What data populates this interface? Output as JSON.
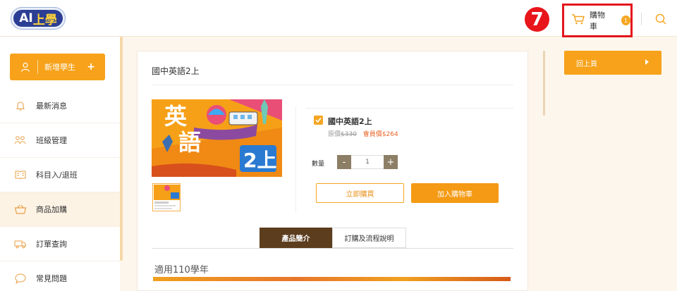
{
  "header": {
    "logo_left": "AI",
    "logo_right": "上學",
    "annotation_number": "7",
    "cart_label": "購物車",
    "cart_count": "1"
  },
  "sidebar": {
    "add_student_label": "新增學生",
    "add_student_plus": "+",
    "items": [
      {
        "label": "最新消息",
        "icon": "bell-icon"
      },
      {
        "label": "班級管理",
        "icon": "people-icon"
      },
      {
        "label": "科目入/退班",
        "icon": "book-icon"
      },
      {
        "label": "商品加購",
        "icon": "basket-icon",
        "active": true
      },
      {
        "label": "訂單查詢",
        "icon": "truck-icon"
      },
      {
        "label": "常見問題",
        "icon": "chat-icon"
      }
    ]
  },
  "product": {
    "title": "國中英語2上",
    "image_text_main": "英語",
    "image_badge": "2上",
    "option_name": "國中英語2上",
    "original_label": "原價",
    "original_price": "$330",
    "member_label": "會員價",
    "member_price": "$264",
    "qty_label": "數量",
    "qty_minus": "-",
    "qty_value": "1",
    "qty_plus": "+",
    "buy_now": "立即購買",
    "add_to_cart": "加入購物車"
  },
  "tabs": {
    "intro": "產品簡介",
    "flow": "訂購及流程說明"
  },
  "content": {
    "applicable": "適用110學年"
  },
  "right_panel": {
    "back_label": "回上頁"
  },
  "colors": {
    "accent": "#f7a21a",
    "highlight_red": "#e3151b",
    "tab_dark": "#5c3d1e"
  }
}
